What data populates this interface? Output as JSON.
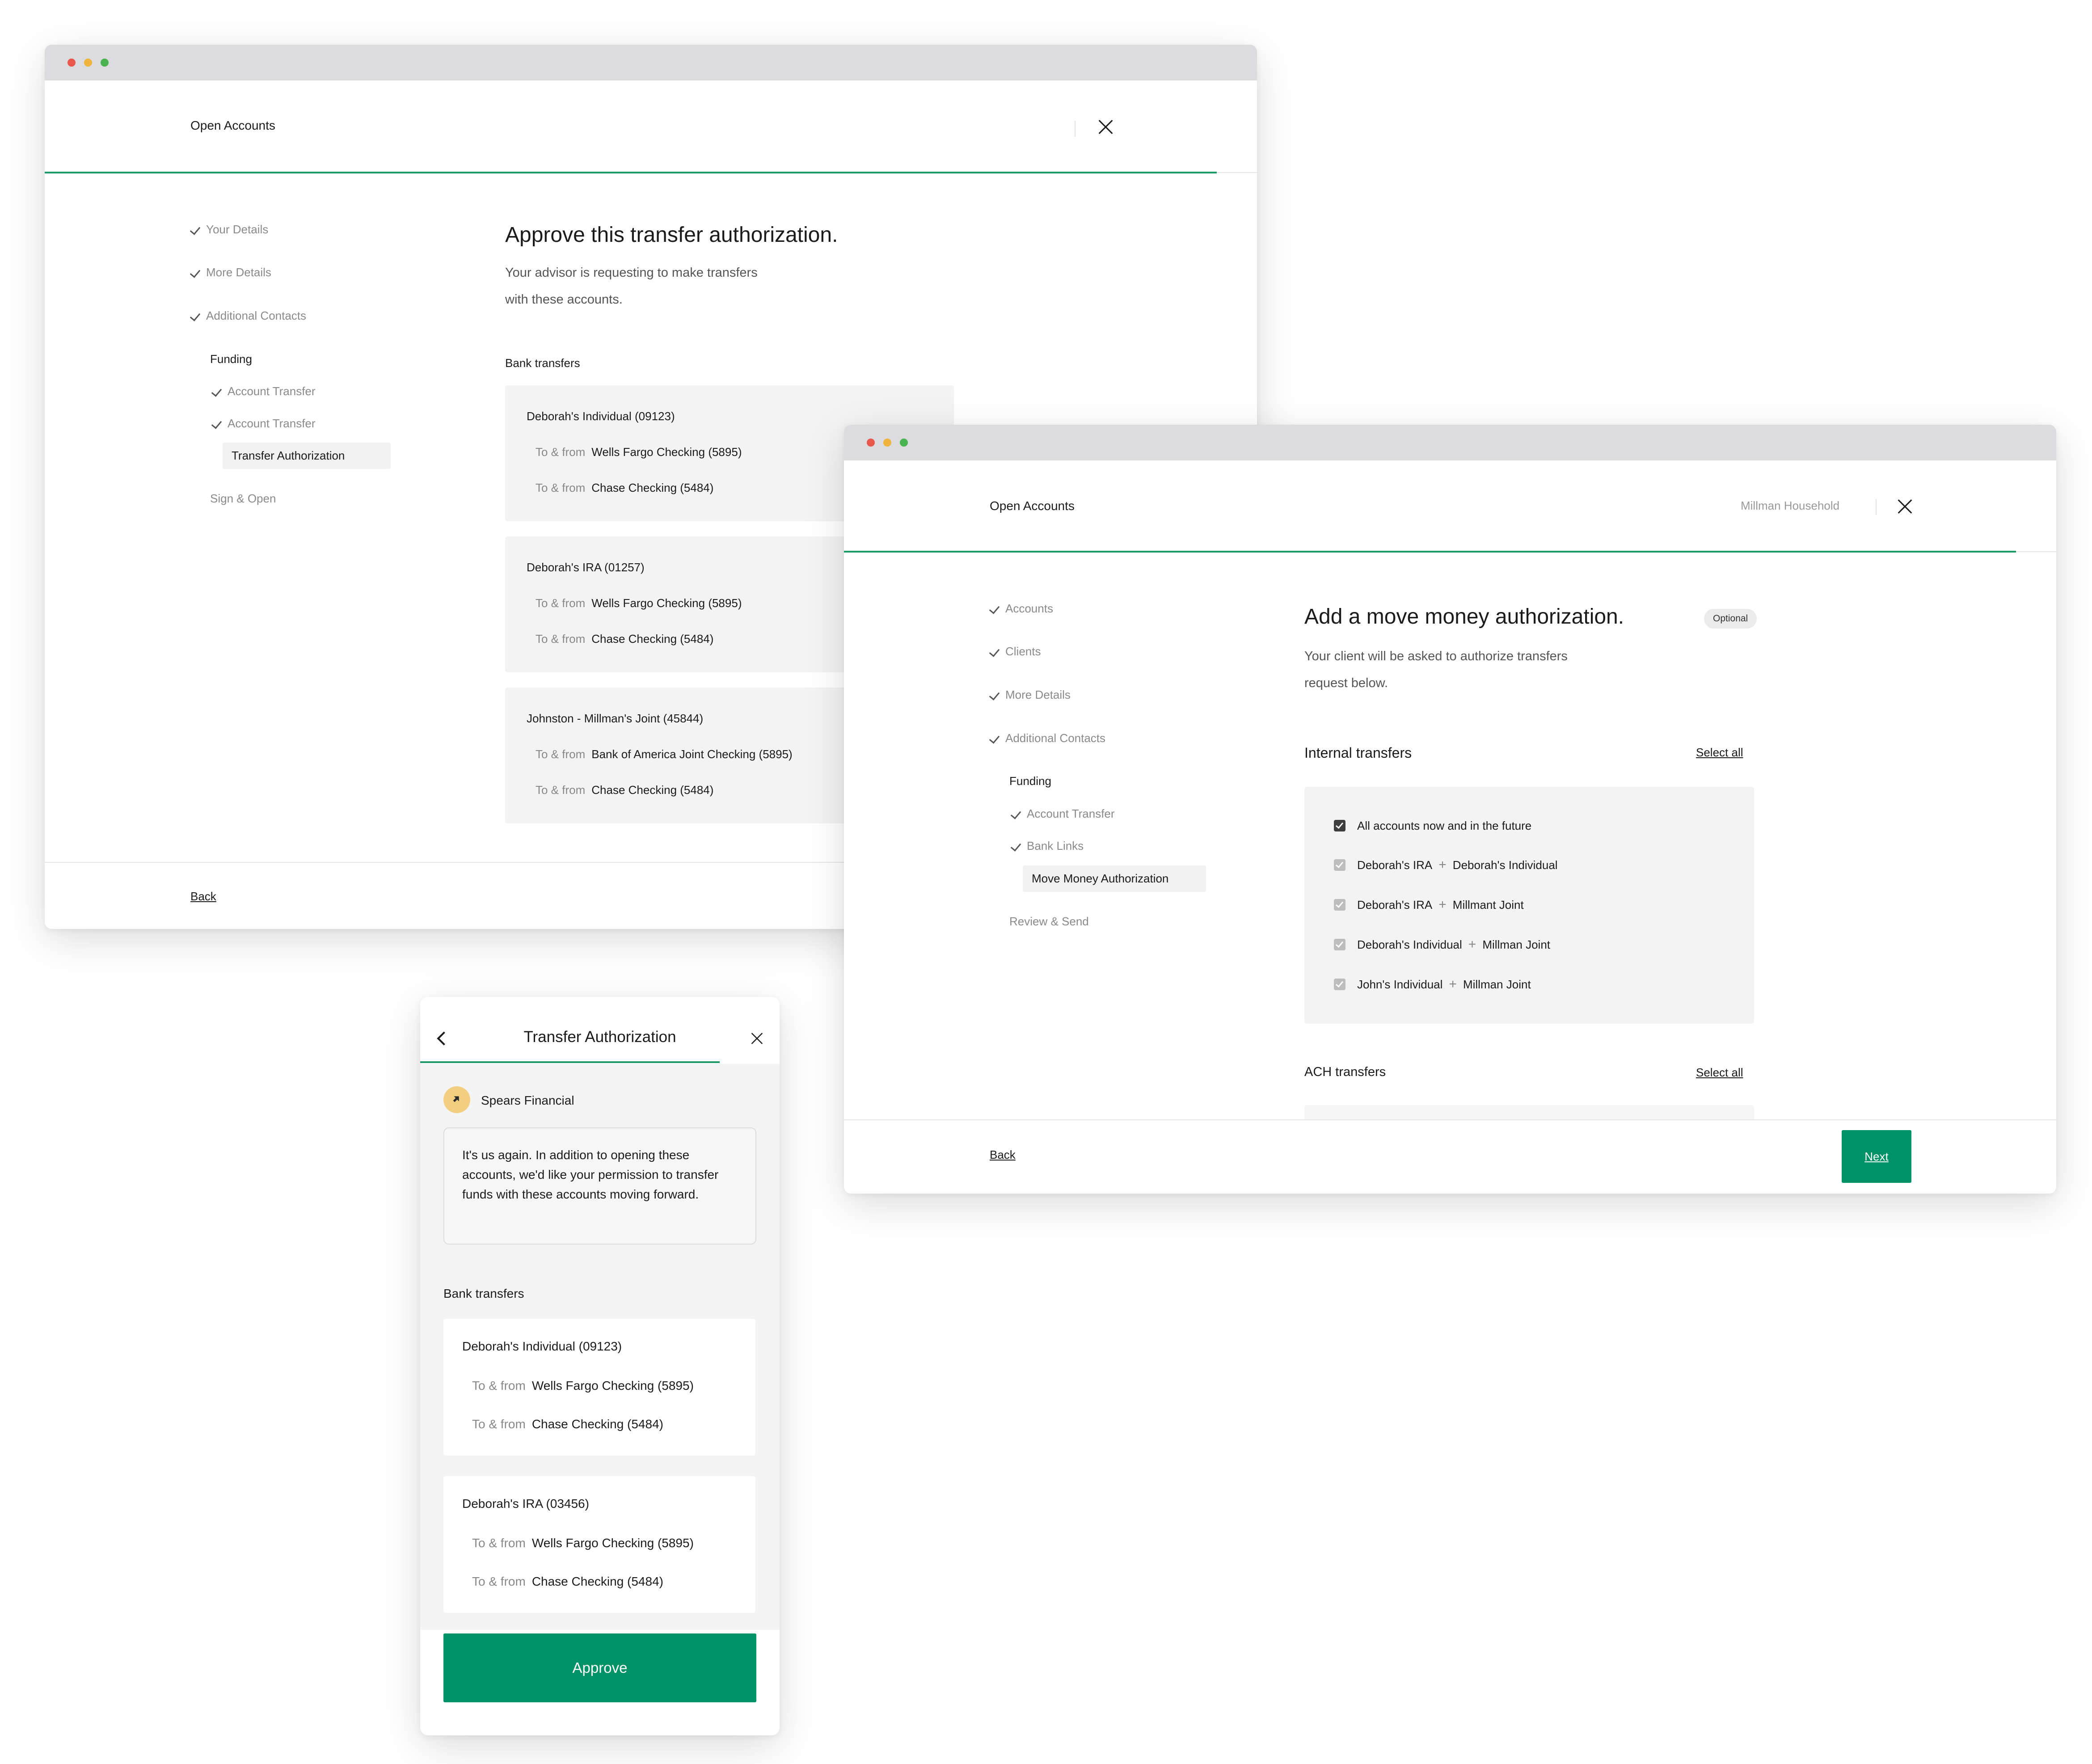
{
  "colors": {
    "accent": "#009267",
    "progress": "#1f9a6a",
    "titlebar": "#dcdcdf",
    "card": "#f3f3f3"
  },
  "window1": {
    "header_title": "Open Accounts",
    "steps": [
      "Your Details",
      "More Details",
      "Additional Contacts"
    ],
    "funding_heading": "Funding",
    "funding_steps": [
      "Account Transfer",
      "Account Transfer"
    ],
    "active_step": "Transfer Authorization",
    "last_step": "Sign & Open",
    "title": "Approve this transfer authorization.",
    "subtitle_line1": "Your advisor is requesting to make transfers",
    "subtitle_line2": "with these accounts.",
    "section_label": "Bank transfers",
    "cards": [
      {
        "title": "Deborah's Individual (09123)",
        "rows": [
          {
            "label": "To & from",
            "value": "Wells Fargo Checking (5895)"
          },
          {
            "label": "To & from",
            "value": "Chase Checking (5484)"
          }
        ]
      },
      {
        "title": "Deborah's IRA (01257)",
        "rows": [
          {
            "label": "To & from",
            "value": "Wells Fargo Checking (5895)"
          },
          {
            "label": "To & from",
            "value": "Chase Checking (5484)"
          }
        ]
      },
      {
        "title": "Johnston - Millman's Joint (45844)",
        "rows": [
          {
            "label": "To & from",
            "value": "Bank of America Joint Checking (5895)"
          },
          {
            "label": "To & from",
            "value": "Chase Checking (5484)"
          }
        ]
      }
    ],
    "back_label": "Back"
  },
  "window2": {
    "header_title": "Open Accounts",
    "household": "Millman Household",
    "steps": [
      "Accounts",
      "Clients",
      "More Details",
      "Additional Contacts"
    ],
    "funding_heading": "Funding",
    "funding_steps": [
      "Account Transfer",
      "Bank Links"
    ],
    "active_step": "Move Money Authorization",
    "last_step": "Review & Send",
    "title": "Add a move money authorization.",
    "badge": "Optional",
    "subtitle_line1": "Your client will be asked to authorize transfers",
    "subtitle_line2": "request below.",
    "internal_label": "Internal transfers",
    "select_all": "Select all",
    "all_accounts": "All accounts now and in the future",
    "pairs": [
      {
        "a": "Deborah's IRA",
        "b": "Deborah's Individual"
      },
      {
        "a": "Deborah's IRA",
        "b": "Millmant Joint"
      },
      {
        "a": "Deborah's Individual",
        "b": "Millman Joint"
      },
      {
        "a": "John's Individual",
        "b": "Millman Joint"
      }
    ],
    "plus": "+",
    "ach_label": "ACH transfers",
    "back_label": "Back",
    "next_label": "Next"
  },
  "mobile": {
    "title": "Transfer Authorization",
    "sender": "Spears Financial",
    "message": "It's us again. In addition to opening these accounts, we'd like your permission to transfer funds with these accounts moving forward.",
    "section_label": "Bank transfers",
    "cards": [
      {
        "title": "Deborah's Individual (09123)",
        "rows": [
          {
            "label": "To & from",
            "value": "Wells Fargo Checking (5895)"
          },
          {
            "label": "To & from",
            "value": "Chase Checking (5484)"
          }
        ]
      },
      {
        "title": "Deborah's IRA (03456)",
        "rows": [
          {
            "label": "To & from",
            "value": "Wells Fargo Checking (5895)"
          },
          {
            "label": "To & from",
            "value": "Chase Checking (5484)"
          }
        ]
      }
    ],
    "approve_label": "Approve"
  }
}
